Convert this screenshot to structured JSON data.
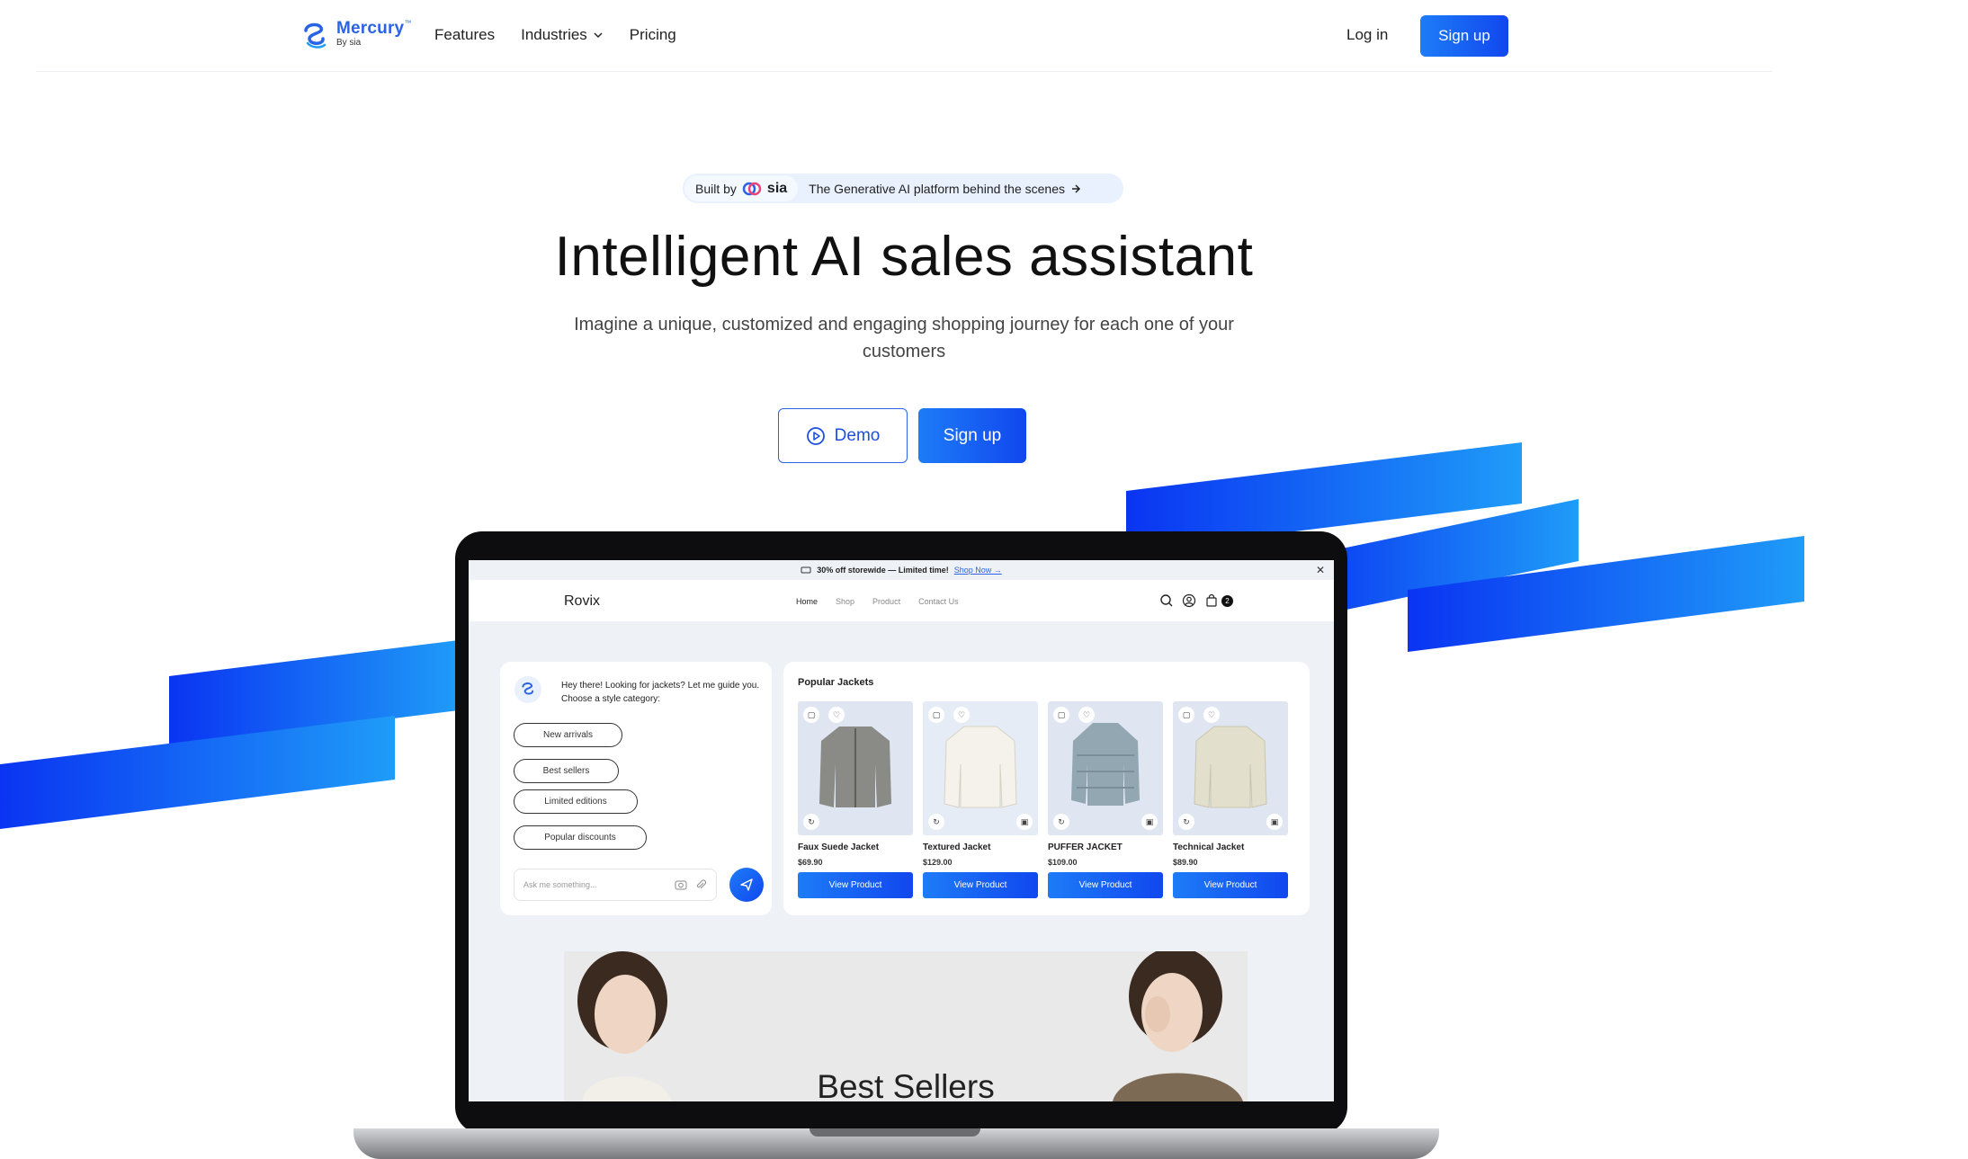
{
  "nav": {
    "brand": "Mercury",
    "brand_tm": "™",
    "brand_by": "By sia",
    "links": [
      "Features",
      "Industries",
      "Pricing"
    ],
    "login": "Log in",
    "signup": "Sign up"
  },
  "hero": {
    "pill_built_by": "Built by",
    "pill_brand": "sia",
    "pill_text": "The Generative AI platform behind the scenes",
    "title": "Intelligent AI sales assistant",
    "subtitle": "Imagine a unique, customized and engaging shopping journey for each one of your customers",
    "demo_button": "Demo",
    "signup_button": "Sign up"
  },
  "preview": {
    "promo_text": "30% off storewide — Limited time!",
    "promo_link": "Shop Now →",
    "shop_name": "Rovix",
    "shop_links": [
      "Home",
      "Shop",
      "Product",
      "Contact Us"
    ],
    "cart_count": "2",
    "chat": {
      "message": "Hey there! Looking for jackets? Let me guide you. Choose a style category:",
      "chips": [
        "New arrivals",
        "Best sellers",
        "Limited editions",
        "Popular discounts"
      ],
      "input_placeholder": "Ask me something..."
    },
    "products_heading": "Popular Jackets",
    "products": [
      {
        "name": "Faux Suede Jacket",
        "price": "$69.90",
        "button": "View Product",
        "color": "#8a8a86"
      },
      {
        "name": "Textured Jacket",
        "price": "$129.00",
        "button": "View Product",
        "color": "#f4f2ea"
      },
      {
        "name": "PUFFER JACKET",
        "price": "$109.00",
        "button": "View Product",
        "color": "#93a7b3"
      },
      {
        "name": "Technical Jacket",
        "price": "$89.90",
        "button": "View Product",
        "color": "#e2dfcc"
      }
    ],
    "banner_text": "Best Sellers"
  },
  "colors": {
    "accent": "#1d7cf7",
    "accent_dark": "#1147ef",
    "brand": "#2a63e6"
  }
}
